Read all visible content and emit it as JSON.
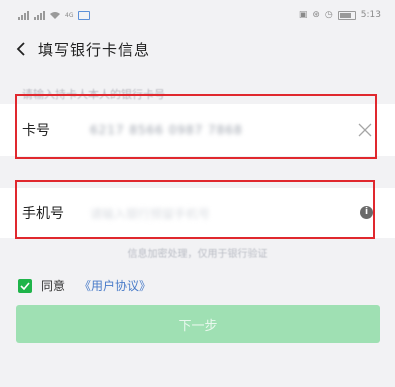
{
  "status_bar": {
    "network": "4G",
    "time": "5:13",
    "battery": "100"
  },
  "header": {
    "title": "填写银行卡信息"
  },
  "form": {
    "hint": "请输入持卡人本人的银行卡号",
    "card": {
      "label": "卡号",
      "value": "6217 8566 0987 7868"
    },
    "phone": {
      "label": "手机号",
      "placeholder": "请输入银行预留手机号"
    },
    "note": "信息加密处理，仅用于银行验证"
  },
  "agreement": {
    "checked": true,
    "label": "同意",
    "link": "《用户协议》"
  },
  "next_button": {
    "label": "下一步"
  },
  "colors": {
    "background": "#f2f2f4",
    "highlight_box": "#e0282e",
    "checkbox": "#1fb44a",
    "link": "#4a7cc9",
    "button_disabled": "#9fe0b3"
  }
}
